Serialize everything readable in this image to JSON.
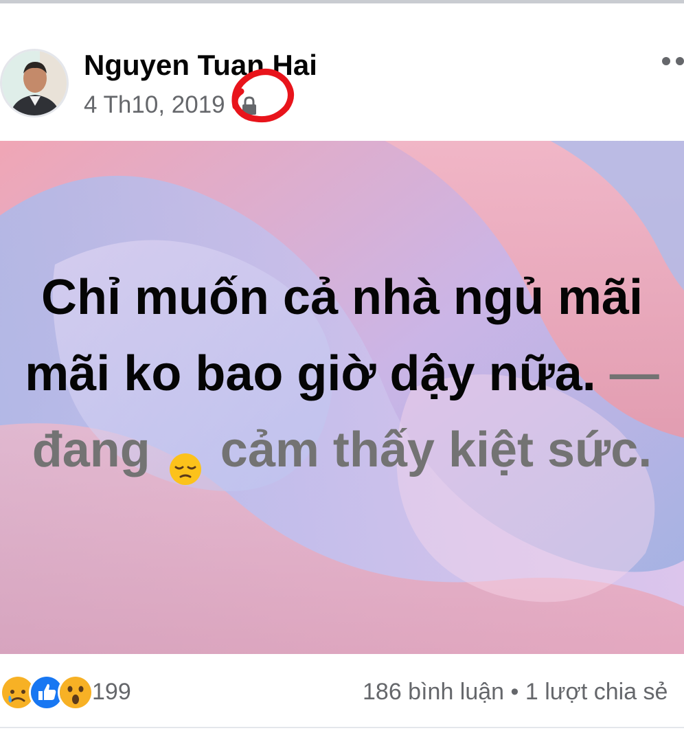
{
  "post": {
    "author": "Nguyen Tuan Hai",
    "date": "4 Th10, 2019",
    "privacy_icon": "lock-icon",
    "text_main": "Chỉ muốn cả nhà ngủ mãi mãi ko bao giờ dậy nữa.",
    "feeling_prefix": "— đang",
    "feeling_emoji": "pensive-face",
    "feeling_text": "cảm thấy kiệt sức."
  },
  "footer": {
    "reaction_icons": [
      "sad-reaction-icon",
      "like-reaction-icon",
      "wow-reaction-icon"
    ],
    "reaction_count": "199",
    "stats": "186 bình luận • 1 lượt chia sẻ"
  },
  "colors": {
    "bg_pink": "#f2a9b7",
    "bg_blue": "#a8b8e6",
    "bg_lavender": "#d9c8ef",
    "feeling_gray": "#737373",
    "meta_gray": "#65676b",
    "annotation_red": "#e8141b"
  }
}
